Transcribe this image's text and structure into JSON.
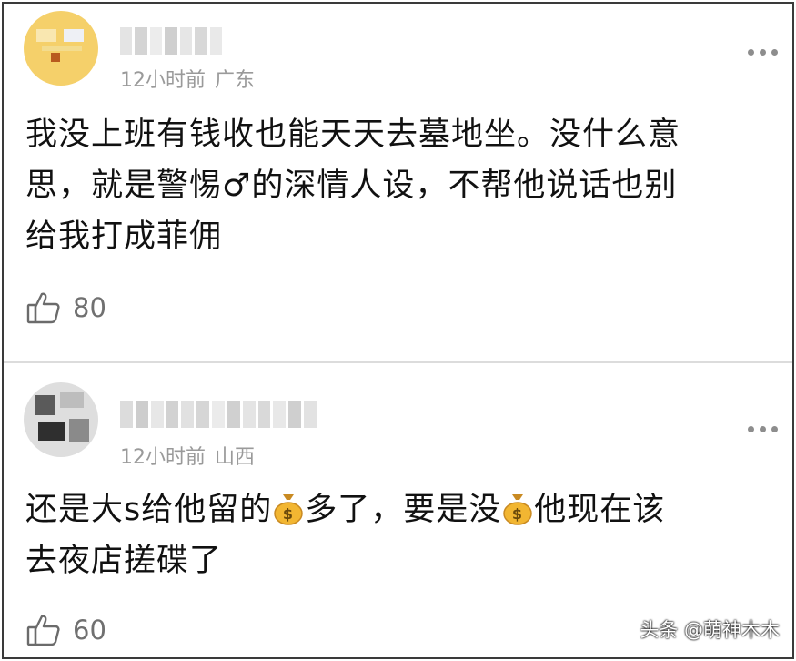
{
  "comments": [
    {
      "time": "12小时前",
      "region": "广东",
      "text_lines": [
        "我没上班有钱收也能天天去墓地坐。没什么意",
        "思，就是警惕♂的深情人设，不帮他说话也别",
        "给我打成菲佣"
      ],
      "likes": "80"
    },
    {
      "time": "12小时前",
      "region": "山西",
      "text_parts": [
        "还是大s给他留的",
        "多了，要是没",
        "他现在该"
      ],
      "text_line2": "去夜店搓碟了",
      "likes": "60"
    }
  ],
  "icons": {
    "like": "thumbs-up-outline-icon",
    "more": "more-dots-icon",
    "money": "money-bag-icon"
  },
  "colors": {
    "meta": "#9a9a9a",
    "text": "#111111",
    "like_count": "#707070",
    "divider": "#dcdcdc"
  },
  "watermark": "头条 @萌神木木"
}
